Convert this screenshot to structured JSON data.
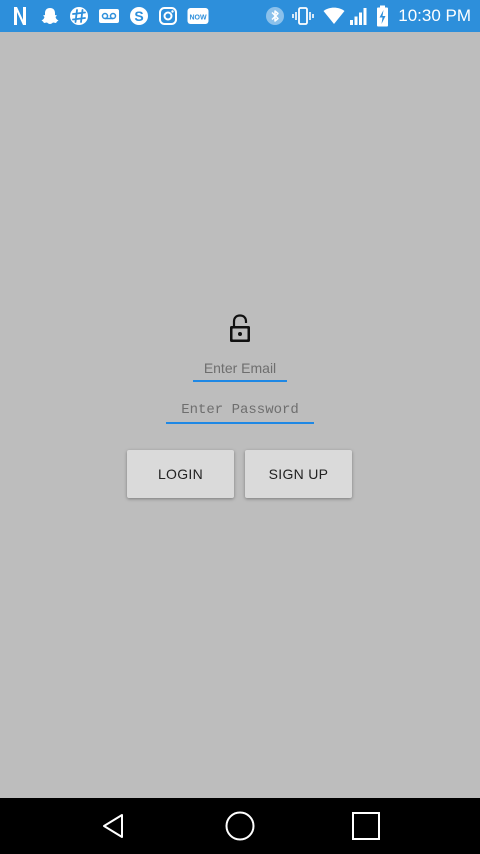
{
  "status_bar": {
    "time": "10:30 PM",
    "left_icons": [
      "netflix-icon",
      "snapchat-icon",
      "slack-icon",
      "voicemail-icon",
      "skype-icon",
      "instagram-icon",
      "now-icon"
    ],
    "now_label": "NOW",
    "right_icons": [
      "bluetooth-icon",
      "vibrate-icon",
      "wifi-icon",
      "signal-icon",
      "battery-charging-icon"
    ],
    "color": "#2d8fdb"
  },
  "login_form": {
    "lock_icon": "lock-open-icon",
    "email_placeholder": "Enter Email",
    "email_value": "",
    "password_placeholder": "Enter Password",
    "password_value": "",
    "login_label": "LOGIN",
    "signup_label": "SIGN UP",
    "accent_color": "#1e88e5"
  },
  "nav_bar": {
    "buttons": [
      "back-icon",
      "home-icon",
      "recents-icon"
    ]
  }
}
